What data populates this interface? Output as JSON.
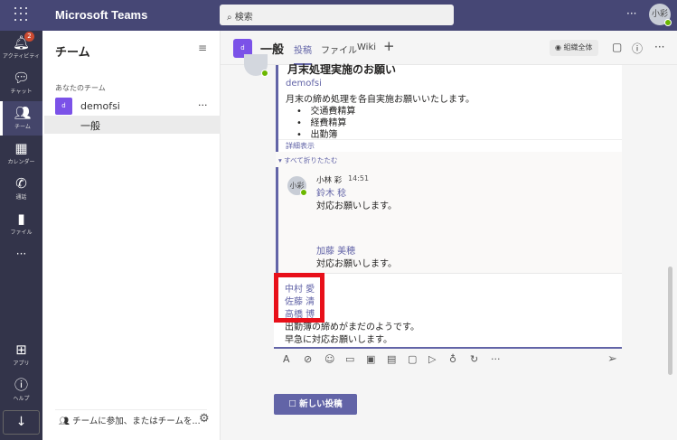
{
  "app": {
    "title": "Microsoft Teams",
    "search_placeholder": "検索",
    "more": "···",
    "user_initials": "小彩"
  },
  "rail": {
    "items": [
      {
        "label": "アクティビティ",
        "icon": "bell-icon",
        "badge": "2"
      },
      {
        "label": "チャット",
        "icon": "chat-icon"
      },
      {
        "label": "チーム",
        "icon": "teams-icon"
      },
      {
        "label": "カレンダー",
        "icon": "calendar-icon"
      },
      {
        "label": "通話",
        "icon": "phone-icon"
      },
      {
        "label": "ファイル",
        "icon": "file-icon"
      },
      {
        "label": "···",
        "icon": "more-icon"
      },
      {
        "label": "アプリ",
        "icon": "apps-icon"
      },
      {
        "label": "ヘルプ",
        "icon": "help-icon"
      }
    ],
    "download_icon": "download-icon"
  },
  "panel": {
    "title": "チーム",
    "section": "あなたのチーム",
    "team": {
      "initial": "d",
      "name": "demofsi",
      "more": "···"
    },
    "channel": "一般",
    "join": "チームに参加、またはチームを..."
  },
  "channel_header": {
    "initial": "d",
    "name": "一般",
    "tabs": [
      "投稿",
      "ファイル",
      "Wiki"
    ],
    "add": "+",
    "org": "組織全体",
    "more": "···"
  },
  "post": {
    "subject": "月末処理実施のお願い",
    "mention": "demofsi",
    "body": "月末の締め処理を各自実施お願いいたします。",
    "bullets": [
      "交通費精算",
      "経費精算",
      "出勤簿"
    ],
    "show_more": "詳細表示"
  },
  "collapse_all": "すべて折りたたむ",
  "reply": {
    "author": "小林 彩",
    "time": "14:51",
    "avatar": "小彩",
    "lines": [
      {
        "mention": "鈴木 稔",
        "text": "対応お願いします。"
      },
      {
        "mention": "加藤 美穂",
        "text": "対応お願いします。"
      }
    ]
  },
  "compose": {
    "mentions": [
      "中村 愛",
      "佐藤 清",
      "高橋 博"
    ],
    "lines": [
      "出勤簿の締めがまだのようです。",
      "早急に対応お願いします。"
    ]
  },
  "new_post": "新しい投稿",
  "colors": {
    "topbar": "#464775",
    "rail": "#33344a",
    "accent": "#6264a7",
    "highlight": "#e8101a",
    "team": "#7b52e8"
  }
}
